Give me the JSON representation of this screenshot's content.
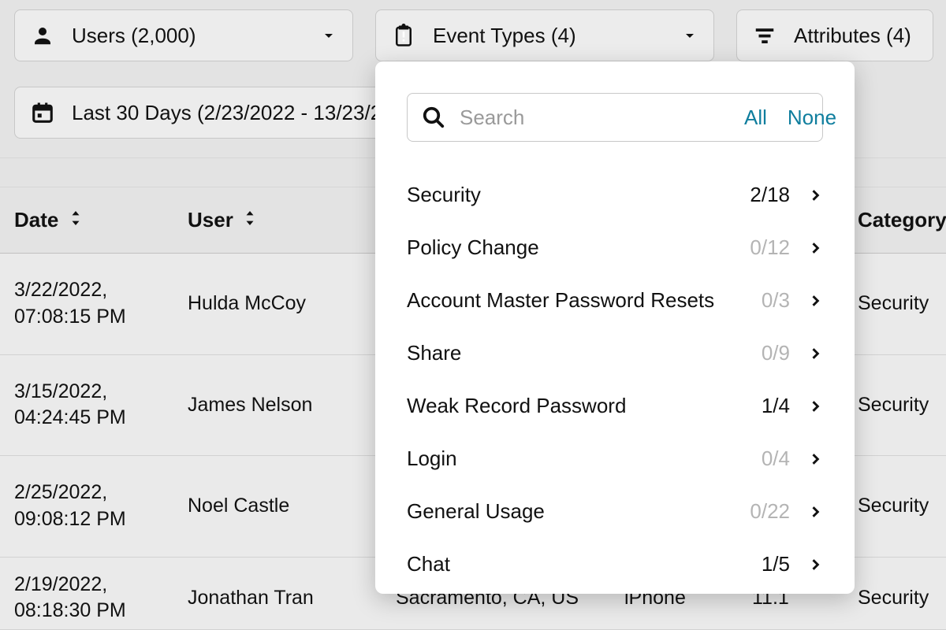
{
  "filters": {
    "users_label": "Users (2,000)",
    "event_types_label": "Event Types (4)",
    "attributes_label": "Attributes (4)",
    "date_label": "Last 30 Days (2/23/2022 - 13/23/2"
  },
  "headers": {
    "date": "Date",
    "user": "User",
    "category": "Category"
  },
  "rows": [
    {
      "date": "3/22/2022,",
      "time": "07:08:15 PM",
      "user": "Hulda McCoy",
      "category": "Security"
    },
    {
      "date": "3/15/2022,",
      "time": "04:24:45 PM",
      "user": "James Nelson",
      "category": "Security"
    },
    {
      "date": "2/25/2022,",
      "time": "09:08:12 PM",
      "user": "Noel Castle",
      "category": "Security"
    },
    {
      "date": "2/19/2022,",
      "time": "08:18:30 PM",
      "user": "Jonathan Tran",
      "location": "Sacramento, CA, US",
      "device": "iPhone",
      "version": "11.1",
      "category": "Security"
    }
  ],
  "dropdown": {
    "search_placeholder": "Search",
    "all": "All",
    "none": "None",
    "items": [
      {
        "label": "Security",
        "count": "2/18",
        "muted": false
      },
      {
        "label": "Policy Change",
        "count": "0/12",
        "muted": true
      },
      {
        "label": "Account Master Password Resets",
        "count": "0/3",
        "muted": true
      },
      {
        "label": "Share",
        "count": "0/9",
        "muted": true
      },
      {
        "label": "Weak Record Password",
        "count": "1/4",
        "muted": false
      },
      {
        "label": "Login",
        "count": "0/4",
        "muted": true
      },
      {
        "label": "General Usage",
        "count": "0/22",
        "muted": true
      },
      {
        "label": "Chat",
        "count": "1/5",
        "muted": false
      }
    ]
  }
}
